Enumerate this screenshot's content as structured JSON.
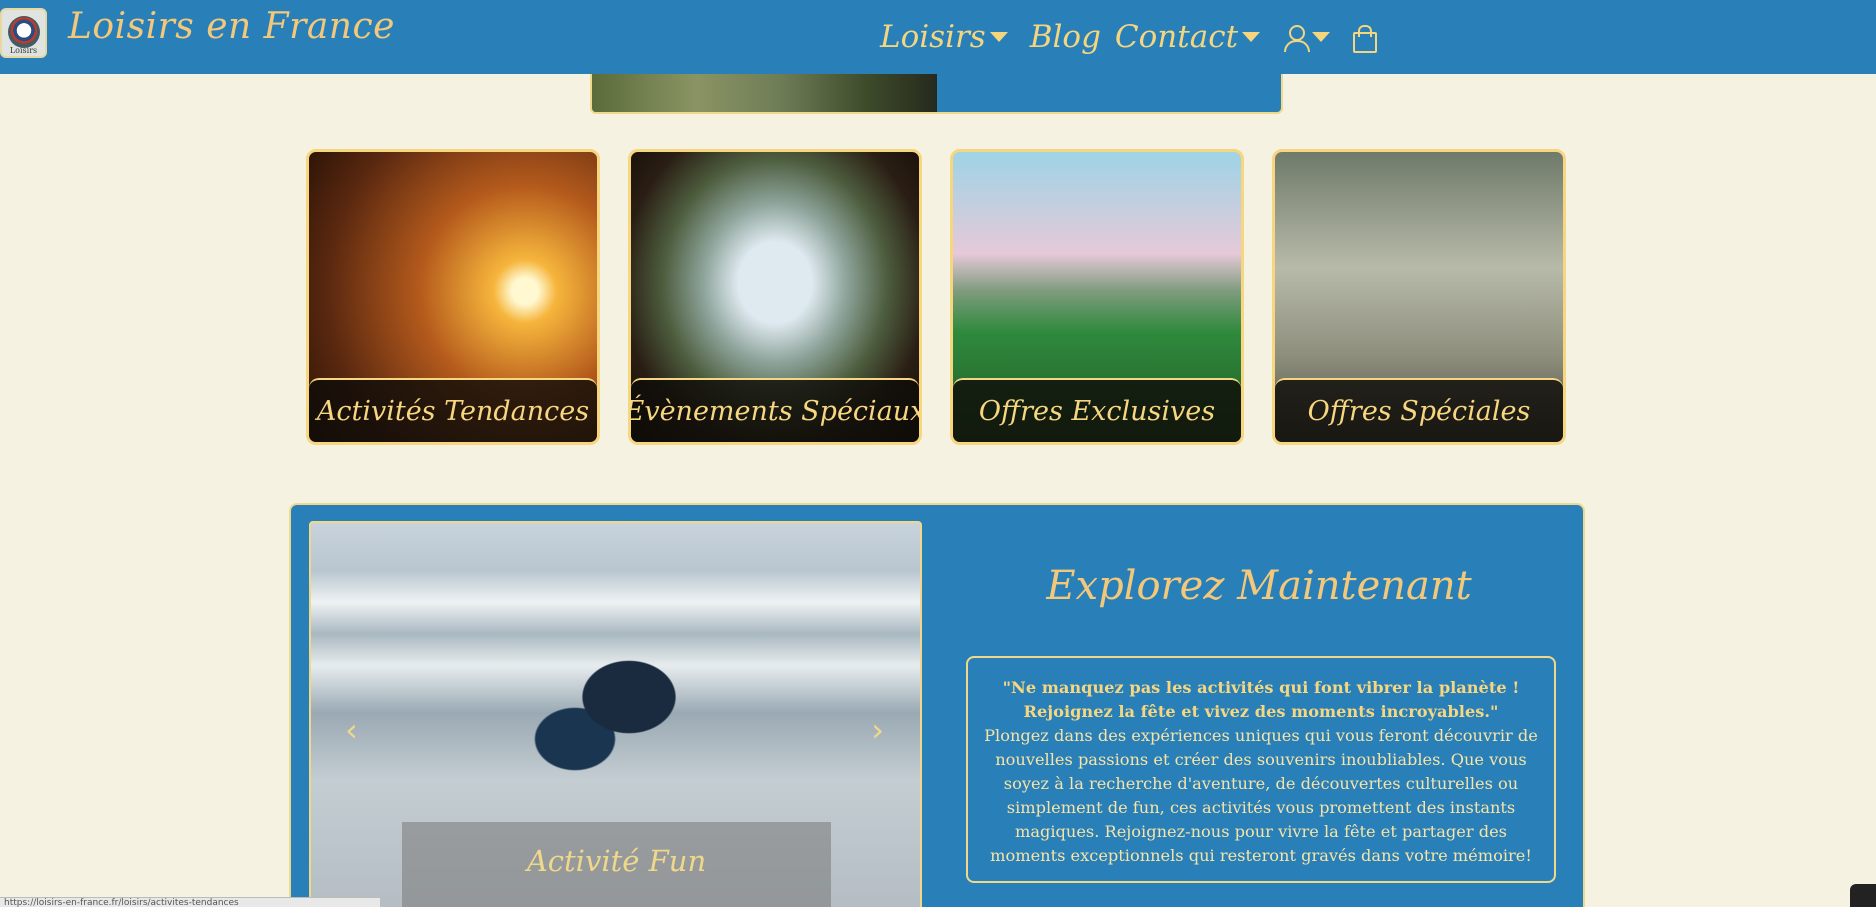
{
  "header": {
    "logo_text": "Loisirs",
    "brand": "Loisirs en France",
    "nav": {
      "loisirs": "Loisirs",
      "blog": "Blog",
      "contact": "Contact"
    }
  },
  "icons": {
    "caret": "caret-down-icon",
    "user": "user-icon",
    "bag": "shopping-bag-icon"
  },
  "categories": [
    {
      "label": "Activités Tendances"
    },
    {
      "label": "Évènements Spéciaux"
    },
    {
      "label": "Offres Exclusives"
    },
    {
      "label": "Offres Spéciales"
    }
  ],
  "explore": {
    "title": "Explorez Maintenant",
    "slide_caption": "Activité Fun",
    "slide_count": 3,
    "active_slide": 1,
    "quote_bold": "\"Ne manquez pas les activités qui font vibrer la planète ! Rejoignez la fête et vivez des moments incroyables.\"",
    "quote_body": "Plongez dans des expériences uniques qui vous feront découvrir de nouvelles passions et créer des souvenirs inoubliables. Que vous soyez à la recherche d'aventure, de découvertes culturelles ou simplement de fun, ces activités vous promettent des instants magiques. Rejoignez-nous pour vivre la fête et partager des moments exceptionnels qui resteront gravés dans votre mémoire!"
  },
  "statusbar": {
    "url": "https://loisirs-en-france.fr/loisirs/activites-tendances"
  },
  "colors": {
    "header_bg": "#2980b9",
    "page_bg": "#f6f2e2",
    "accent_gold": "#f7d680",
    "brand_text": "#f3c87a"
  }
}
